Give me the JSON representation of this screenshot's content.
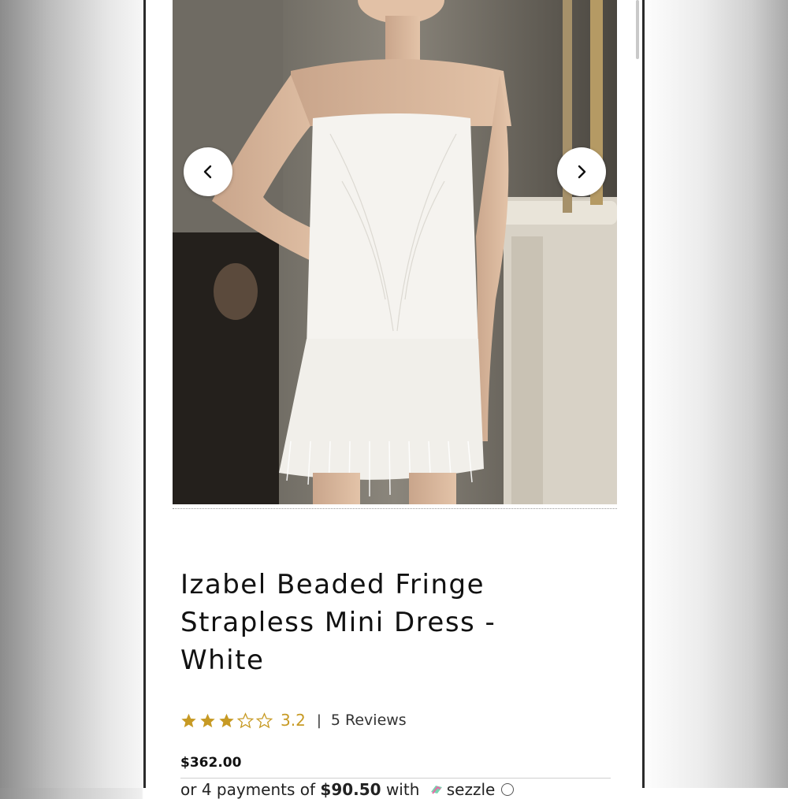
{
  "product": {
    "title": "Izabel Beaded Fringe Strapless Mini Dress - White",
    "title_lines": [
      "Izabel Beaded Fringe",
      "Strapless Mini Dress -",
      "White"
    ],
    "rating_value": "3.2",
    "rating": 3.2,
    "rating_max": 5,
    "reviews_label": "5 Reviews",
    "separator": "|",
    "price": "$362.00"
  },
  "installments": {
    "prefix": "or 4 payments of",
    "amount": "$90.50",
    "suffix": "with",
    "provider": "sezzle"
  },
  "gallery": {
    "image_alt": "Model wearing white beaded fringe strapless mini dress"
  },
  "icons": {
    "prev": "chevron-left-icon",
    "next": "chevron-right-icon",
    "star_full": "star-filled-icon",
    "star_empty": "star-outline-icon",
    "info": "info-icon"
  },
  "colors": {
    "star": "#c79a24",
    "rating_text": "#c79a24",
    "text": "#111111"
  }
}
